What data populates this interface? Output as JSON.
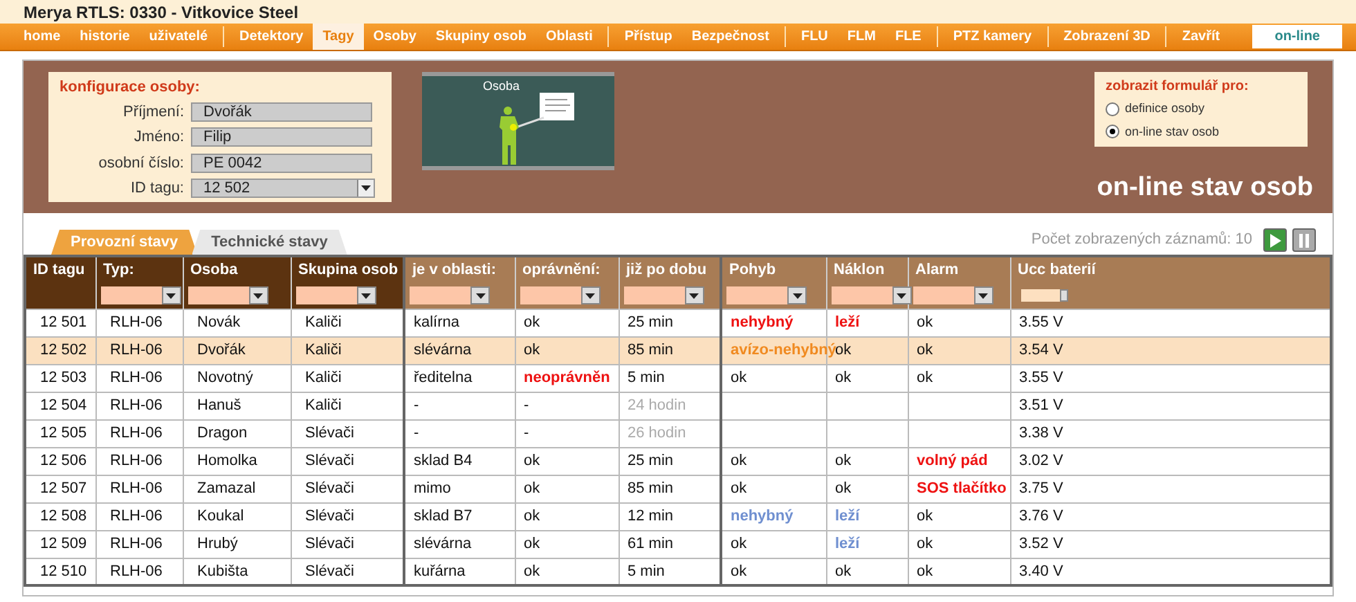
{
  "window": {
    "title": "Merya RTLS:  0330 - Vitkovice Steel"
  },
  "nav": [
    {
      "label": "home",
      "selected": false,
      "separator_before": false
    },
    {
      "label": "historie",
      "selected": false,
      "separator_before": false
    },
    {
      "label": "uživatelé",
      "selected": false,
      "separator_before": false
    },
    {
      "label": "Detektory",
      "selected": false,
      "separator_before": true
    },
    {
      "label": "Tagy",
      "selected": true,
      "separator_before": false
    },
    {
      "label": "Osoby",
      "selected": false,
      "separator_before": false
    },
    {
      "label": "Skupiny osob",
      "selected": false,
      "separator_before": false
    },
    {
      "label": "Oblasti",
      "selected": false,
      "separator_before": false
    },
    {
      "label": "Přístup",
      "selected": false,
      "separator_before": true
    },
    {
      "label": "Bezpečnost",
      "selected": false,
      "separator_before": false
    },
    {
      "label": "FLU",
      "selected": false,
      "separator_before": true
    },
    {
      "label": "FLM",
      "selected": false,
      "separator_before": false
    },
    {
      "label": "FLE",
      "selected": false,
      "separator_before": false
    },
    {
      "label": "PTZ kamery",
      "selected": false,
      "separator_before": true
    },
    {
      "label": "Zobrazení 3D",
      "selected": false,
      "separator_before": true
    },
    {
      "label": "Zavřít",
      "selected": false,
      "separator_before": true
    }
  ],
  "online_badge": "on-line",
  "person_config": {
    "title": "konfigurace osoby:",
    "fields": [
      {
        "label": "Příjmení:",
        "value": "Dvořák",
        "kind": "text"
      },
      {
        "label": "Jméno:",
        "value": "Filip",
        "kind": "text"
      },
      {
        "label": "osobní číslo:",
        "value": "PE 0042",
        "kind": "text"
      },
      {
        "label": "ID tagu:",
        "value": "12 502",
        "kind": "select"
      }
    ]
  },
  "preview": {
    "caption": "Osoba"
  },
  "form_selector": {
    "title": "zobrazit formulář pro:",
    "options": [
      {
        "label": "definice osoby",
        "selected": false
      },
      {
        "label": "on-line stav osob",
        "selected": true
      }
    ]
  },
  "panel_heading": "on-line stav osob",
  "tabs": [
    {
      "label": "Provozní stavy",
      "selected": true
    },
    {
      "label": "Technické stavy",
      "selected": false
    }
  ],
  "record_count": "Počet zobrazených záznamů: 10",
  "playback": {
    "playing": true
  },
  "table": {
    "columns": [
      {
        "label": "ID tagu",
        "key_column": true,
        "kind": "plain"
      },
      {
        "label": "Typ:",
        "key_column": true,
        "kind": "filter"
      },
      {
        "label": "Osoba",
        "key_column": true,
        "kind": "filter"
      },
      {
        "label": "Skupina osob",
        "key_column": true,
        "kind": "filter"
      },
      {
        "label": "je v oblasti:",
        "key_column": false,
        "kind": "filter"
      },
      {
        "label": "oprávnění:",
        "key_column": false,
        "kind": "filter"
      },
      {
        "label": "již po dobu",
        "key_column": false,
        "kind": "filter"
      },
      {
        "label": "Pohyb",
        "key_column": false,
        "kind": "filter"
      },
      {
        "label": "Náklon",
        "key_column": false,
        "kind": "filter"
      },
      {
        "label": "Alarm",
        "key_column": false,
        "kind": "filter"
      },
      {
        "label": "Ucc baterií",
        "key_column": false,
        "kind": "compact"
      }
    ],
    "rows": [
      {
        "selected": false,
        "cells": [
          {
            "text": "12 501",
            "kind": "normal"
          },
          {
            "text": "RLH-06",
            "kind": "normal"
          },
          {
            "text": "Novák",
            "kind": "normal"
          },
          {
            "text": "Kaliči",
            "kind": "normal"
          },
          {
            "text": "kalírna",
            "kind": "normal"
          },
          {
            "text": "ok",
            "kind": "normal"
          },
          {
            "text": "25 min",
            "kind": "normal"
          },
          {
            "text": "nehybný",
            "kind": "alarm"
          },
          {
            "text": "leží",
            "kind": "alarm"
          },
          {
            "text": "ok",
            "kind": "normal"
          },
          {
            "text": "3.55 V",
            "kind": "normal"
          }
        ]
      },
      {
        "selected": true,
        "cells": [
          {
            "text": "12 502",
            "kind": "normal"
          },
          {
            "text": "RLH-06",
            "kind": "normal"
          },
          {
            "text": "Dvořák",
            "kind": "normal"
          },
          {
            "text": "Kaliči",
            "kind": "normal"
          },
          {
            "text": "slévárna",
            "kind": "normal"
          },
          {
            "text": "ok",
            "kind": "normal"
          },
          {
            "text": "85 min",
            "kind": "normal"
          },
          {
            "text": "avízo-nehybný",
            "kind": "warning"
          },
          {
            "text": "ok",
            "kind": "normal"
          },
          {
            "text": "ok",
            "kind": "normal"
          },
          {
            "text": "3.54 V",
            "kind": "normal"
          }
        ]
      },
      {
        "selected": false,
        "cells": [
          {
            "text": "12 503",
            "kind": "normal"
          },
          {
            "text": "RLH-06",
            "kind": "normal"
          },
          {
            "text": "Novotný",
            "kind": "normal"
          },
          {
            "text": "Kaliči",
            "kind": "normal"
          },
          {
            "text": "ředitelna",
            "kind": "normal"
          },
          {
            "text": "neoprávněn",
            "kind": "alarm"
          },
          {
            "text": "5 min",
            "kind": "normal"
          },
          {
            "text": "ok",
            "kind": "normal"
          },
          {
            "text": "ok",
            "kind": "normal"
          },
          {
            "text": "ok",
            "kind": "normal"
          },
          {
            "text": "3.55 V",
            "kind": "normal"
          }
        ]
      },
      {
        "selected": false,
        "cells": [
          {
            "text": "12 504",
            "kind": "normal"
          },
          {
            "text": "RLH-06",
            "kind": "normal"
          },
          {
            "text": "Hanuš",
            "kind": "normal"
          },
          {
            "text": "Kaliči",
            "kind": "normal"
          },
          {
            "text": "-",
            "kind": "normal"
          },
          {
            "text": "-",
            "kind": "normal"
          },
          {
            "text": "24 hodin",
            "kind": "muted"
          },
          null,
          null,
          null,
          {
            "text": "3.51 V",
            "kind": "normal"
          }
        ]
      },
      {
        "selected": false,
        "cells": [
          {
            "text": "12 505",
            "kind": "normal"
          },
          {
            "text": "RLH-06",
            "kind": "normal"
          },
          {
            "text": "Dragon",
            "kind": "normal"
          },
          {
            "text": "Slévači",
            "kind": "normal"
          },
          {
            "text": "-",
            "kind": "normal"
          },
          {
            "text": "-",
            "kind": "normal"
          },
          {
            "text": "26 hodin",
            "kind": "muted"
          },
          null,
          null,
          null,
          {
            "text": "3.38 V",
            "kind": "normal"
          }
        ]
      },
      {
        "selected": false,
        "cells": [
          {
            "text": "12 506",
            "kind": "normal"
          },
          {
            "text": "RLH-06",
            "kind": "normal"
          },
          {
            "text": "Homolka",
            "kind": "normal"
          },
          {
            "text": "Slévači",
            "kind": "normal"
          },
          {
            "text": "sklad B4",
            "kind": "normal"
          },
          {
            "text": "ok",
            "kind": "normal"
          },
          {
            "text": "25 min",
            "kind": "normal"
          },
          {
            "text": "ok",
            "kind": "normal"
          },
          {
            "text": "ok",
            "kind": "normal"
          },
          {
            "text": "volný pád",
            "kind": "alarm"
          },
          {
            "text": "3.02 V",
            "kind": "normal"
          }
        ]
      },
      {
        "selected": false,
        "cells": [
          {
            "text": "12 507",
            "kind": "normal"
          },
          {
            "text": "RLH-06",
            "kind": "normal"
          },
          {
            "text": "Zamazal",
            "kind": "normal"
          },
          {
            "text": "Slévači",
            "kind": "normal"
          },
          {
            "text": "mimo",
            "kind": "normal"
          },
          {
            "text": "ok",
            "kind": "normal"
          },
          {
            "text": "85 min",
            "kind": "normal"
          },
          {
            "text": "ok",
            "kind": "normal"
          },
          {
            "text": "ok",
            "kind": "normal"
          },
          {
            "text": "SOS tlačítko",
            "kind": "alarm"
          },
          {
            "text": "3.75 V",
            "kind": "normal"
          }
        ]
      },
      {
        "selected": false,
        "cells": [
          {
            "text": "12 508",
            "kind": "normal"
          },
          {
            "text": "RLH-06",
            "kind": "normal"
          },
          {
            "text": "Koukal",
            "kind": "normal"
          },
          {
            "text": "Slévači",
            "kind": "normal"
          },
          {
            "text": "sklad B7",
            "kind": "normal"
          },
          {
            "text": "ok",
            "kind": "normal"
          },
          {
            "text": "12 min",
            "kind": "normal"
          },
          {
            "text": "nehybný",
            "kind": "info"
          },
          {
            "text": "leží",
            "kind": "info"
          },
          {
            "text": "ok",
            "kind": "normal"
          },
          {
            "text": "3.76 V",
            "kind": "normal"
          }
        ]
      },
      {
        "selected": false,
        "cells": [
          {
            "text": "12 509",
            "kind": "normal"
          },
          {
            "text": "RLH-06",
            "kind": "normal"
          },
          {
            "text": "Hrubý",
            "kind": "normal"
          },
          {
            "text": "Slévači",
            "kind": "normal"
          },
          {
            "text": "slévárna",
            "kind": "normal"
          },
          {
            "text": "ok",
            "kind": "normal"
          },
          {
            "text": "61 min",
            "kind": "normal"
          },
          {
            "text": "ok",
            "kind": "normal"
          },
          {
            "text": "leží",
            "kind": "info"
          },
          {
            "text": "ok",
            "kind": "normal"
          },
          {
            "text": "3.52 V",
            "kind": "normal"
          }
        ]
      },
      {
        "selected": false,
        "cells": [
          {
            "text": "12 510",
            "kind": "normal"
          },
          {
            "text": "RLH-06",
            "kind": "normal"
          },
          {
            "text": "Kubišta",
            "kind": "normal"
          },
          {
            "text": "Slévači",
            "kind": "normal"
          },
          {
            "text": "kuřárna",
            "kind": "normal"
          },
          {
            "text": "ok",
            "kind": "normal"
          },
          {
            "text": "5 min",
            "kind": "normal"
          },
          {
            "text": "ok",
            "kind": "normal"
          },
          {
            "text": "ok",
            "kind": "normal"
          },
          {
            "text": "ok",
            "kind": "normal"
          },
          {
            "text": "3.40 V",
            "kind": "normal"
          }
        ]
      }
    ]
  }
}
